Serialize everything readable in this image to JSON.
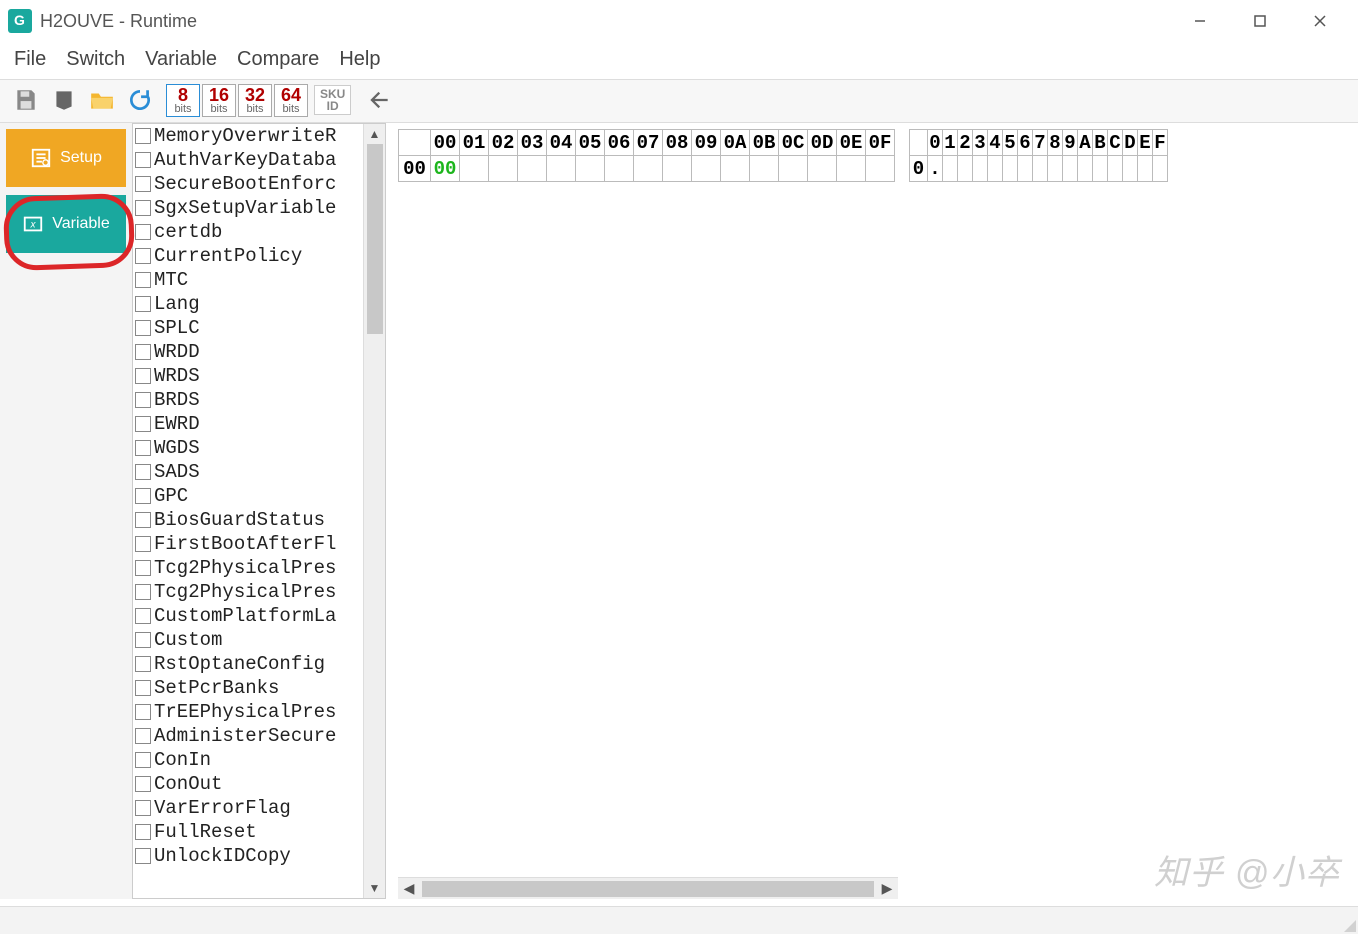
{
  "window": {
    "title": "H2OUVE - Runtime"
  },
  "menu": {
    "file": "File",
    "switch": "Switch",
    "variable": "Variable",
    "compare": "Compare",
    "help": "Help"
  },
  "toolbar": {
    "bits": [
      {
        "num": "8",
        "label": "bits",
        "active": true
      },
      {
        "num": "16",
        "label": "bits",
        "active": false
      },
      {
        "num": "32",
        "label": "bits",
        "active": false
      },
      {
        "num": "64",
        "label": "bits",
        "active": false
      }
    ],
    "sku_top": "SKU",
    "sku_bot": "ID"
  },
  "side": {
    "setup": "Setup",
    "variable": "Variable"
  },
  "variables": [
    "MemoryOverwriteR",
    "AuthVarKeyDataba",
    "SecureBootEnforc",
    "SgxSetupVariable",
    "certdb",
    "CurrentPolicy",
    "MTC",
    "Lang",
    "SPLC",
    "WRDD",
    "WRDS",
    "BRDS",
    "EWRD",
    "WGDS",
    "SADS",
    "GPC",
    "BiosGuardStatus",
    "FirstBootAfterFl",
    "Tcg2PhysicalPres",
    "Tcg2PhysicalPres",
    "CustomPlatformLa",
    "Custom",
    "RstOptaneConfig",
    "SetPcrBanks",
    "TrEEPhysicalPres",
    "AdministerSecure",
    "ConIn",
    "ConOut",
    "VarErrorFlag",
    "FullReset",
    "UnlockIDCopy"
  ],
  "hex": {
    "cols": [
      "00",
      "01",
      "02",
      "03",
      "04",
      "05",
      "06",
      "07",
      "08",
      "09",
      "0A",
      "0B",
      "0C",
      "0D",
      "0E",
      "0F"
    ],
    "ascii_cols": [
      "0",
      "1",
      "2",
      "3",
      "4",
      "5",
      "6",
      "7",
      "8",
      "9",
      "A",
      "B",
      "C",
      "D",
      "E",
      "F"
    ],
    "row_header": "00",
    "ascii_row_header": "0",
    "value_00": "00",
    "ascii_value_0": "."
  },
  "watermark": "知乎 @小卒"
}
